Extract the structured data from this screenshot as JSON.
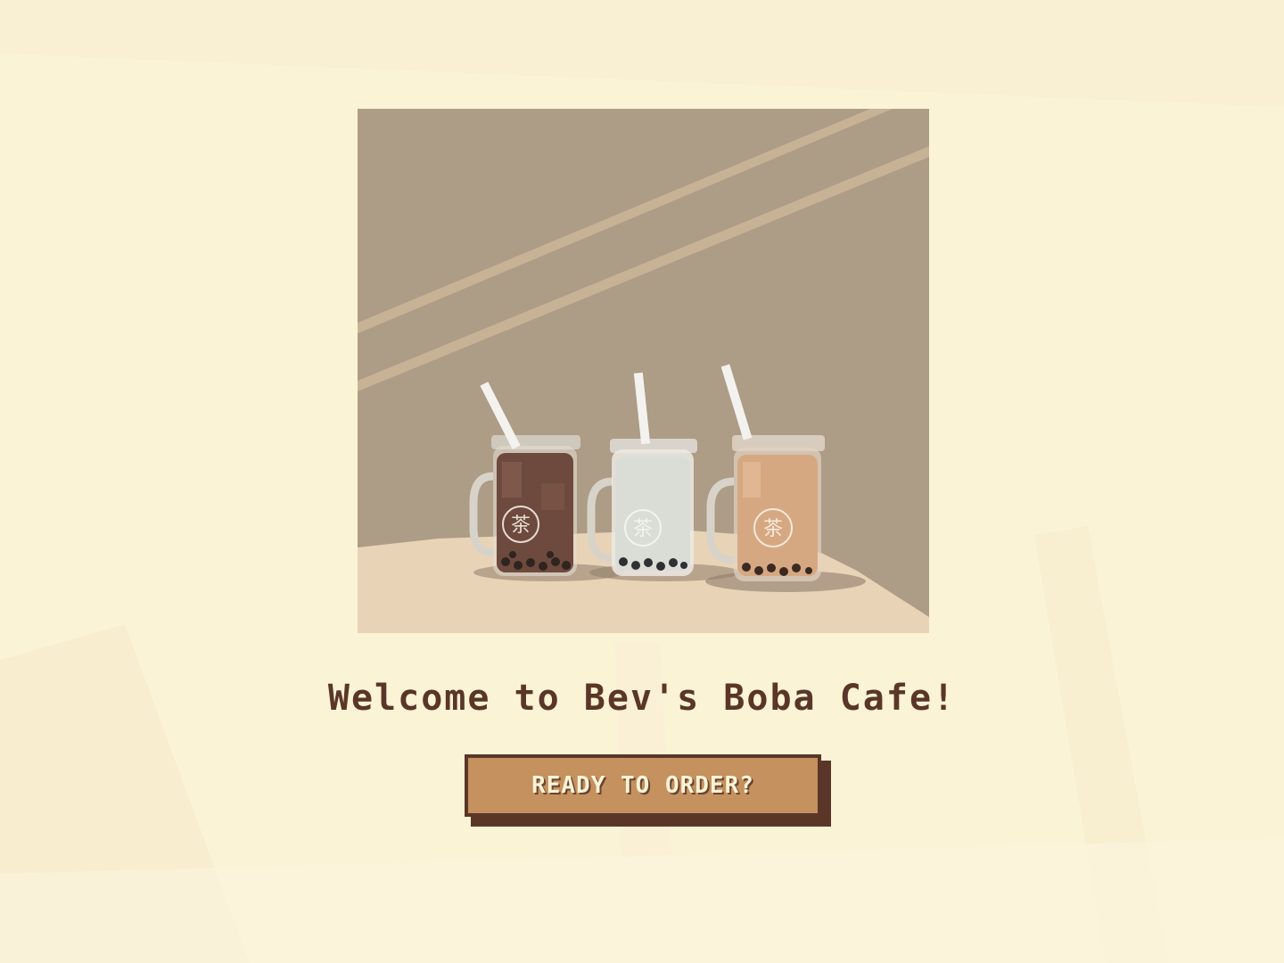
{
  "welcome": {
    "title": "Welcome to Bev's Boba Cafe!",
    "cta_label": "READY TO ORDER?"
  },
  "hero": {
    "mug_glyph": "茶",
    "drinks": [
      "chocolate-milk-tea",
      "white-milk-tea",
      "classic-milk-tea"
    ]
  },
  "colors": {
    "background": "#fbf3d6",
    "text_brown": "#5a3628",
    "button_fill": "#c4915f",
    "wall": "#ad9c86",
    "table": "#e9d3b7"
  }
}
